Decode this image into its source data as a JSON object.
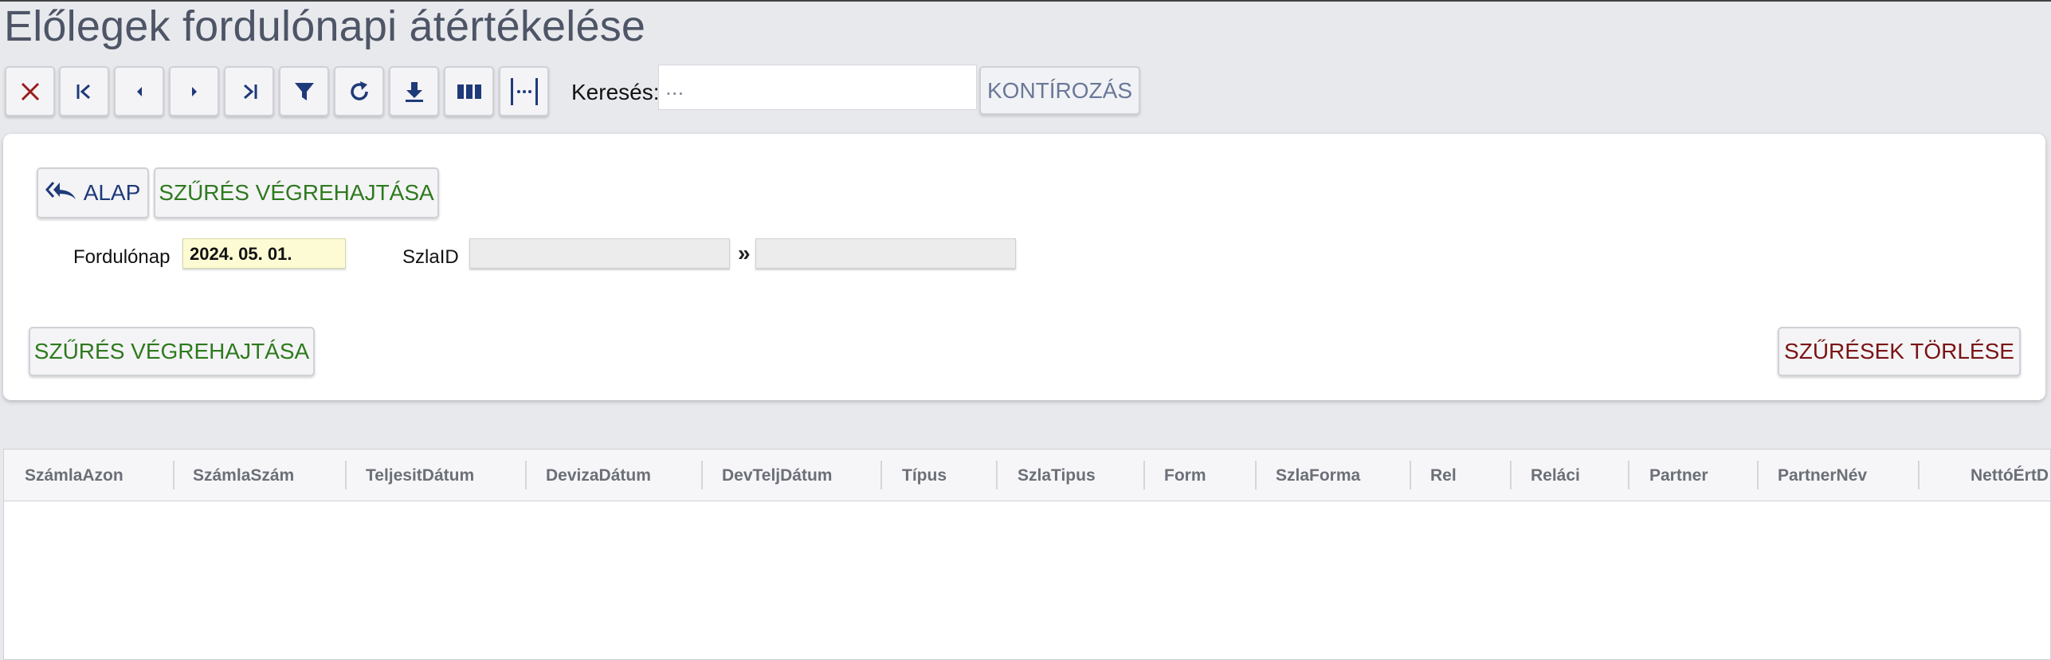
{
  "page": {
    "title": "Előlegek fordulónapi átértékelése"
  },
  "toolbar": {
    "buttons": [
      {
        "name": "close-button",
        "icon": "close-icon",
        "color": "#9b1c1c"
      },
      {
        "name": "first-record-button",
        "icon": "first-icon",
        "color": "#1f3a7a"
      },
      {
        "name": "previous-record-button",
        "icon": "prev-icon",
        "color": "#1f3a7a"
      },
      {
        "name": "next-record-button",
        "icon": "next-icon",
        "color": "#1f3a7a"
      },
      {
        "name": "last-record-button",
        "icon": "last-icon",
        "color": "#1f3a7a"
      },
      {
        "name": "filter-button",
        "icon": "filter-icon",
        "color": "#1f3a7a"
      },
      {
        "name": "refresh-button",
        "icon": "refresh-icon",
        "color": "#1f3a7a"
      },
      {
        "name": "download-button",
        "icon": "download-icon",
        "color": "#1f3a7a"
      },
      {
        "name": "columns-button",
        "icon": "columns-icon",
        "color": "#1f3a7a"
      },
      {
        "name": "column-width-button",
        "icon": "column-width-icon",
        "color": "#1f3a7a"
      }
    ],
    "search_label": "Keresés:",
    "search_placeholder": "...",
    "search_value": "",
    "kontir_label": "KONTÍROZÁS"
  },
  "filter": {
    "alap_label": "ALAP",
    "apply_top_label": "SZŰRÉS VÉGREHAJTÁSA",
    "fordulonap_label": "Fordulónap",
    "fordulonap_value": "2024. 05. 01.",
    "szlaid_label": "SzlaID",
    "szlaid_from": "",
    "szlaid_to": "",
    "range_separator": "»",
    "apply_bottom_label": "SZŰRÉS VÉGREHAJTÁSA",
    "clear_label": "SZŰRÉSEK TÖRLÉSE"
  },
  "grid": {
    "columns": [
      "SzámlaAzon",
      "SzámlaSzám",
      "TeljesitDátum",
      "DevizaDátum",
      "DevTeljDátum",
      "Típus",
      "SzlaTipus",
      "Form",
      "SzlaForma",
      "Rel",
      "Reláci",
      "Partner",
      "PartnerNév",
      "NettóÉrtD"
    ],
    "rows": []
  }
}
